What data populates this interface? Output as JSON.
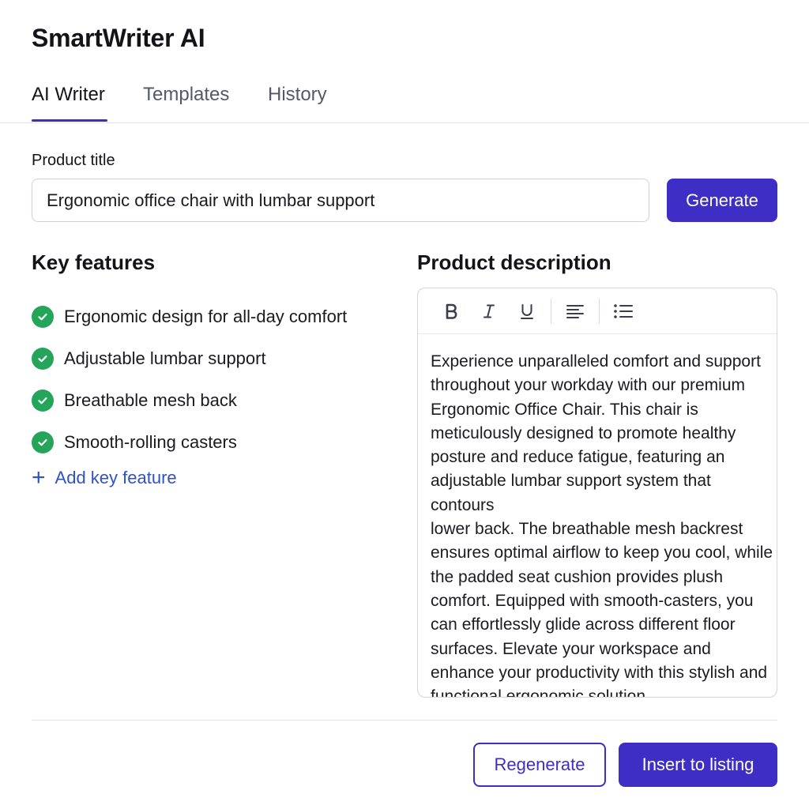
{
  "app": {
    "title": "SmartWriter AI"
  },
  "tabs": [
    {
      "label": "AI Writer",
      "active": true
    },
    {
      "label": "Templates",
      "active": false
    },
    {
      "label": "History",
      "active": false
    }
  ],
  "form": {
    "product_title_label": "Product title",
    "product_title_value": "Ergonomic office chair with lumbar support",
    "generate_label": "Generate"
  },
  "features": {
    "heading": "Key features",
    "items": [
      "Ergonomic design for all-day comfort",
      "Adjustable lumbar support",
      "Breathable mesh back",
      "Smooth-rolling casters"
    ],
    "add_label": "Add key feature",
    "check_icon": "check-circle-icon",
    "check_color": "#25a55a"
  },
  "description": {
    "heading": "Product description",
    "toolbar": [
      "bold-icon",
      "italic-icon",
      "underline-icon",
      "align-left-icon",
      "bullet-list-icon"
    ],
    "text": "Experience unparalleled comfort and support\nthroughout your workday with our premium\nErgonomic Office Chair. This chair is\nmeticulously designed to promote healthy\nposture and reduce fatigue, featuring an\nadjustable lumbar support system that contours\nlower back. The breathable mesh backrest\nensures optimal airflow to keep you cool, while\nthe padded seat cushion provides plush\ncomfort. Equipped with smooth-casters, you\ncan effortlessly glide across different floor\nsurfaces. Elevate your workspace and\nenhance your productivity with this stylish and\nfunctional ergonomic solution."
  },
  "actions": {
    "regenerate_label": "Regenerate",
    "insert_label": "Insert to listing"
  },
  "colors": {
    "accent": "#3f2ec5",
    "link": "#2f52c8",
    "success": "#25a55a"
  }
}
